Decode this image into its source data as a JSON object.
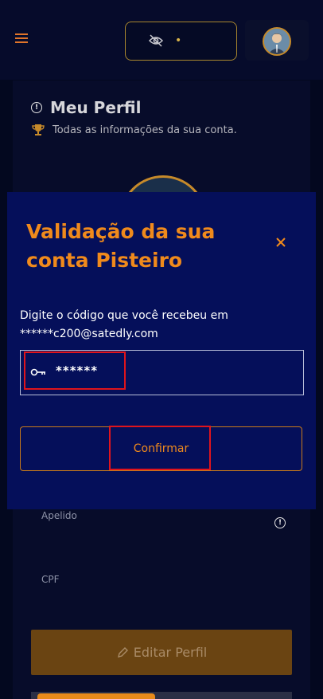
{
  "header": {
    "menu_icon": "hamburger-menu-icon",
    "balance_hidden_icon": "eye-off-icon",
    "balance_value": "•",
    "avatar_icon": "user-avatar"
  },
  "profile": {
    "title": "Meu Perfil",
    "subtitle": "Todas as informações da sua conta.",
    "fields": [
      {
        "label": "Apelido"
      },
      {
        "label": "CPF"
      }
    ],
    "edit_button": "Editar Perfil"
  },
  "modal": {
    "title": "Validação da sua conta Pisteiro",
    "description": "Digite o código que você recebeu em ******c200@satedly.com",
    "code_value": "******",
    "confirm_button": "Confirmar",
    "close_icon": "close-icon"
  },
  "colors": {
    "accent": "#f08a1c",
    "modal_bg": "#050f5a",
    "page_bg": "#03081f",
    "highlight": "#e0141c"
  }
}
